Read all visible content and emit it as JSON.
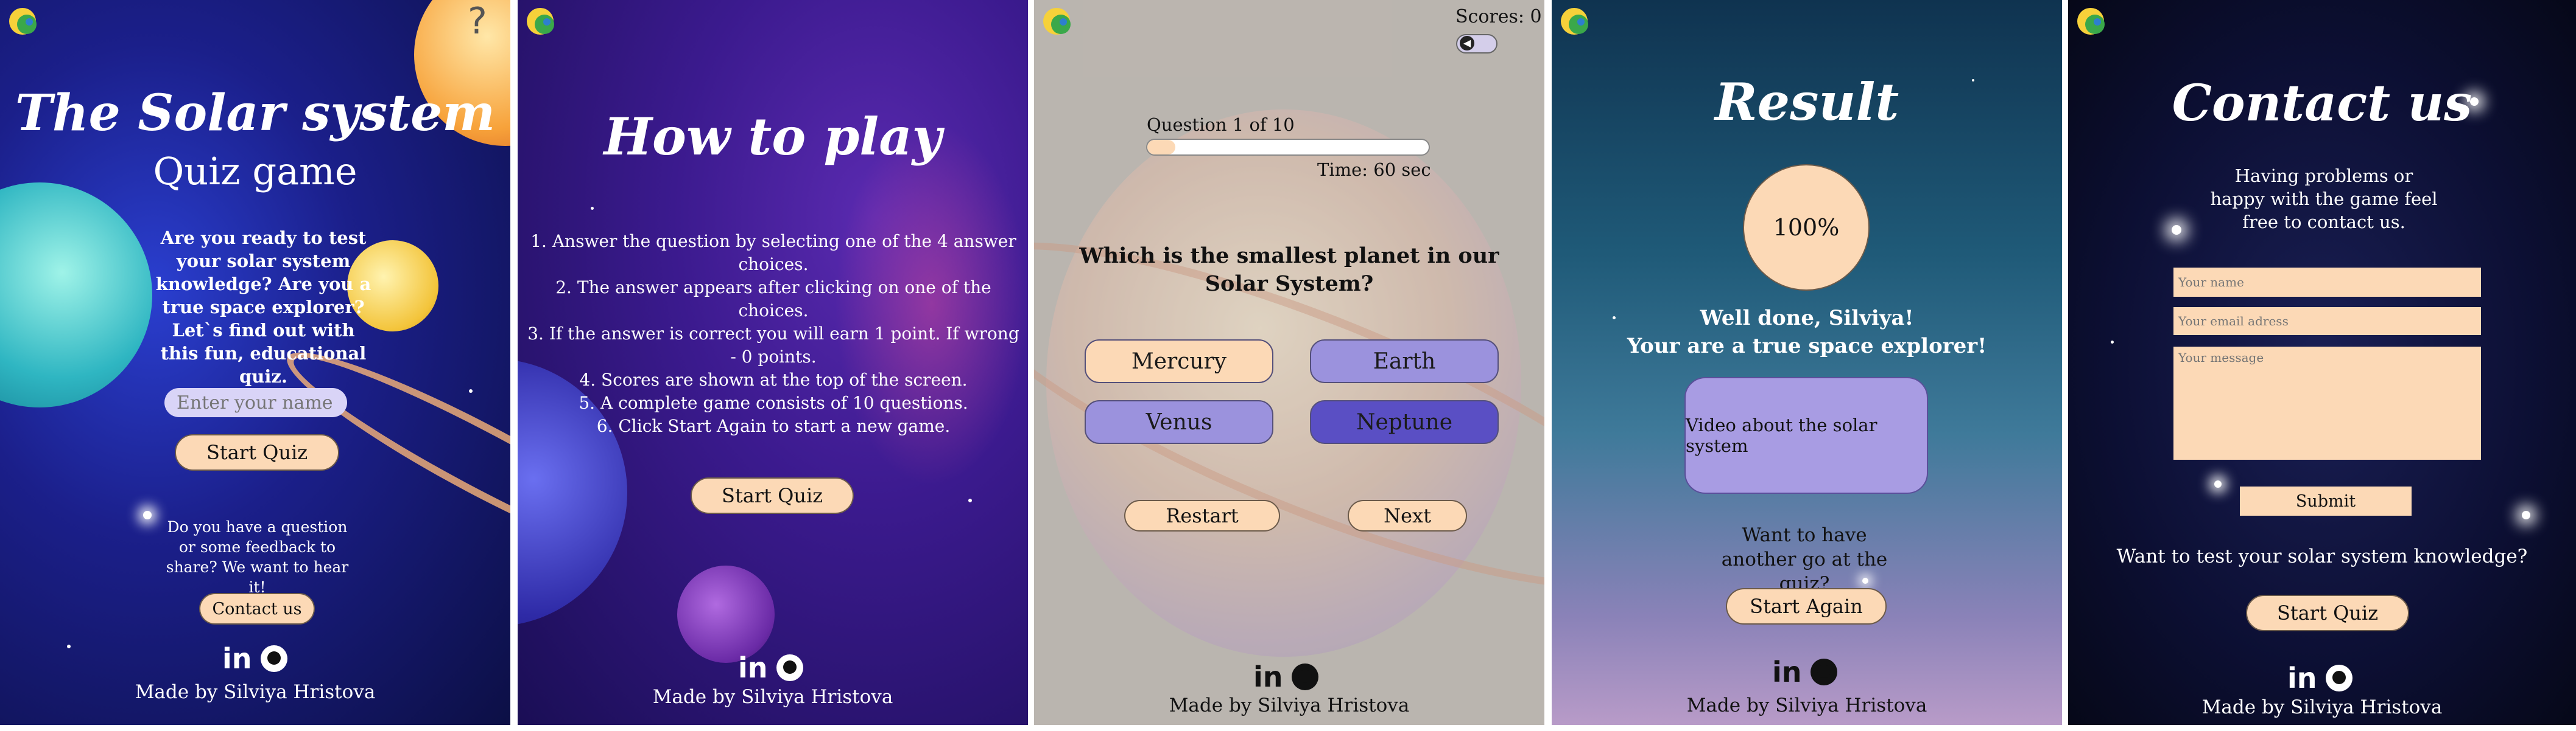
{
  "panels": {
    "start": {
      "help_glyph": "?",
      "title_line1": "The Solar system",
      "title_line2": "Quiz game",
      "intro": "Are you ready to test your solar system knowledge? Are you a true space explorer? Let`s find out with this fun, educational quiz.",
      "name_placeholder": "Enter your name",
      "start_label": "Start Quiz",
      "feedback_text": "Do you have a question or some feedback to share? We want to hear it!",
      "contact_label": "Contact us",
      "footer": "Made by Silviya Hristova"
    },
    "howto": {
      "title": "How to play",
      "rules": [
        "1. Answer the question by selecting one of the 4 answer choices.",
        "2. The answer appears after clicking on one of the choices.",
        "3. If the answer is correct you will earn 1 point. If wrong - 0 points.",
        "4. Scores are shown at the top of the screen.",
        "5. A complete game consists of 10 questions.",
        "6. Click Start Again to start a new game."
      ],
      "start_label": "Start Quiz",
      "footer": "Made by Silviya Hristova"
    },
    "quiz": {
      "scores_label": "Scores: 0",
      "question_counter": "Question 1 of 10",
      "progress_fraction": 0.1,
      "timer": "Time: 60 sec",
      "question": "Which is the smallest planet in our Solar System?",
      "answers": [
        "Mercury",
        "Earth",
        "Venus",
        "Neptune"
      ],
      "restart_label": "Restart",
      "next_label": "Next",
      "footer": "Made by Silviya Hristova"
    },
    "result": {
      "title": "Result",
      "score_percent": "100%",
      "message_line1": "Well done, Silviya!",
      "message_line2": "Your are a true space explorer!",
      "video_label": "Video about the solar system",
      "again_text": "Want to have another go at the quiz?",
      "start_again_label": "Start Again",
      "footer": "Made by Silviya Hristova"
    },
    "contact": {
      "title": "Contact us",
      "intro": "Having problems or happy with the game feel free to contact us.",
      "name_placeholder": "Your name",
      "email_placeholder": "Your email adress",
      "message_placeholder": "Your message",
      "submit_label": "Submit",
      "test_text": "Want to test your solar system knowledge?",
      "start_label": "Start Quiz",
      "footer": "Made by Silviya Hristova"
    }
  },
  "colors": {
    "button_bg": "#fcd9b6",
    "answer_selected": "#9b92dd",
    "answer_dark": "#5a4fc4",
    "video_bg": "#a89ce3"
  }
}
